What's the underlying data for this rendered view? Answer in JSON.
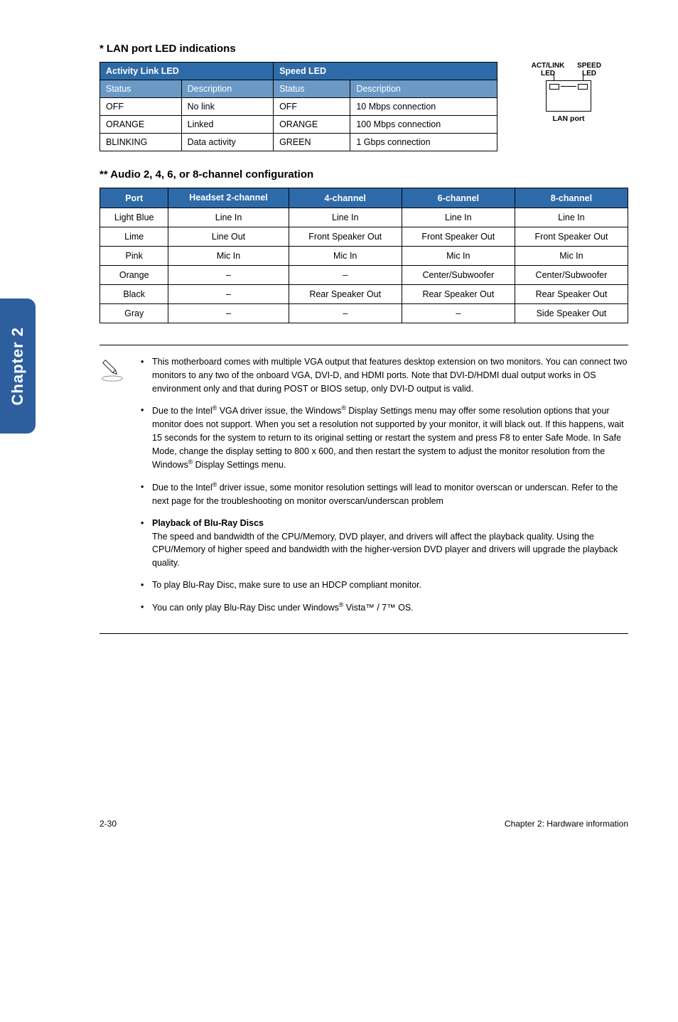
{
  "side_tab": "Chapter 2",
  "lan_section": {
    "title": "* LAN port LED indications",
    "group_headers": [
      "Activity Link LED",
      "Speed LED"
    ],
    "sub_headers": [
      "Status",
      "Description",
      "Status",
      "Description"
    ],
    "rows": [
      [
        "OFF",
        "No link",
        "OFF",
        "10 Mbps connection"
      ],
      [
        "ORANGE",
        "Linked",
        "ORANGE",
        "100 Mbps connection"
      ],
      [
        "BLINKING",
        "Data activity",
        "GREEN",
        "1 Gbps connection"
      ]
    ],
    "diagram": {
      "left_label": "ACT/LINK LED",
      "right_label": "SPEED LED",
      "caption": "LAN port"
    }
  },
  "audio_section": {
    "title": "** Audio 2, 4, 6, or 8-channel configuration",
    "headers": [
      "Port",
      "Headset 2-channel",
      "4-channel",
      "6-channel",
      "8-channel"
    ],
    "rows": [
      [
        "Light Blue",
        "Line In",
        "Line In",
        "Line In",
        "Line In"
      ],
      [
        "Lime",
        "Line Out",
        "Front Speaker Out",
        "Front Speaker Out",
        "Front Speaker Out"
      ],
      [
        "Pink",
        "Mic In",
        "Mic In",
        "Mic In",
        "Mic In"
      ],
      [
        "Orange",
        "–",
        "–",
        "Center/Subwoofer",
        "Center/Subwoofer"
      ],
      [
        "Black",
        "–",
        "Rear Speaker Out",
        "Rear Speaker Out",
        "Rear Speaker Out"
      ],
      [
        "Gray",
        "–",
        "–",
        "–",
        "Side Speaker Out"
      ]
    ]
  },
  "notes": {
    "n1": "This motherboard comes with multiple VGA output that features desktop extension on two monitors. You can connect two monitors to any two of the onboard VGA, DVI-D, and HDMI ports. Note that DVI-D/HDMI dual output works in OS environment only and that during POST or BIOS setup, only DVI-D output is valid.",
    "n2_a": "Due to the Intel",
    "n2_b": " VGA driver issue, the Windows",
    "n2_c": " Display Settings menu may offer some resolution options that your monitor does not support. When you set a resolution not supported by your monitor, it will black out. If this happens, wait 15 seconds for the system to return to its original setting or restart the system and press F8 to enter Safe Mode. In Safe Mode, change the display setting to 800 x 600, and then restart the system to adjust the monitor resolution from the Windows",
    "n2_d": " Display Settings menu.",
    "n3_a": "Due to the Intel",
    "n3_b": " driver issue, some monitor resolution settings will lead to monitor overscan or underscan. Refer to the next page for the troubleshooting on monitor overscan/underscan problem",
    "n4_title": "Playback of Blu-Ray Discs",
    "n4_body": "The speed and bandwidth of the CPU/Memory, DVD player, and drivers will affect the playback quality. Using the CPU/Memory of higher speed and bandwidth with the higher-version DVD player and drivers will upgrade the playback quality.",
    "n5": "To play Blu-Ray Disc, make sure to use an HDCP compliant monitor.",
    "n6_a": "You can only play Blu-Ray Disc under Windows",
    "n6_b": " Vista™ / 7™ OS."
  },
  "footer": {
    "left": "2-30",
    "right": "Chapter 2: Hardware information"
  },
  "chart_data": [
    {
      "type": "table",
      "title": "LAN port LED indications",
      "columns": [
        "Activity Status",
        "Activity Description",
        "Speed Status",
        "Speed Description"
      ],
      "rows": [
        [
          "OFF",
          "No link",
          "OFF",
          "10 Mbps connection"
        ],
        [
          "ORANGE",
          "Linked",
          "ORANGE",
          "100 Mbps connection"
        ],
        [
          "BLINKING",
          "Data activity",
          "GREEN",
          "1 Gbps connection"
        ]
      ]
    },
    {
      "type": "table",
      "title": "Audio 2, 4, 6, or 8-channel configuration",
      "columns": [
        "Port",
        "Headset 2-channel",
        "4-channel",
        "6-channel",
        "8-channel"
      ],
      "rows": [
        [
          "Light Blue",
          "Line In",
          "Line In",
          "Line In",
          "Line In"
        ],
        [
          "Lime",
          "Line Out",
          "Front Speaker Out",
          "Front Speaker Out",
          "Front Speaker Out"
        ],
        [
          "Pink",
          "Mic In",
          "Mic In",
          "Mic In",
          "Mic In"
        ],
        [
          "Orange",
          "–",
          "–",
          "Center/Subwoofer",
          "Center/Subwoofer"
        ],
        [
          "Black",
          "–",
          "Rear Speaker Out",
          "Rear Speaker Out",
          "Rear Speaker Out"
        ],
        [
          "Gray",
          "–",
          "–",
          "–",
          "Side Speaker Out"
        ]
      ]
    }
  ]
}
